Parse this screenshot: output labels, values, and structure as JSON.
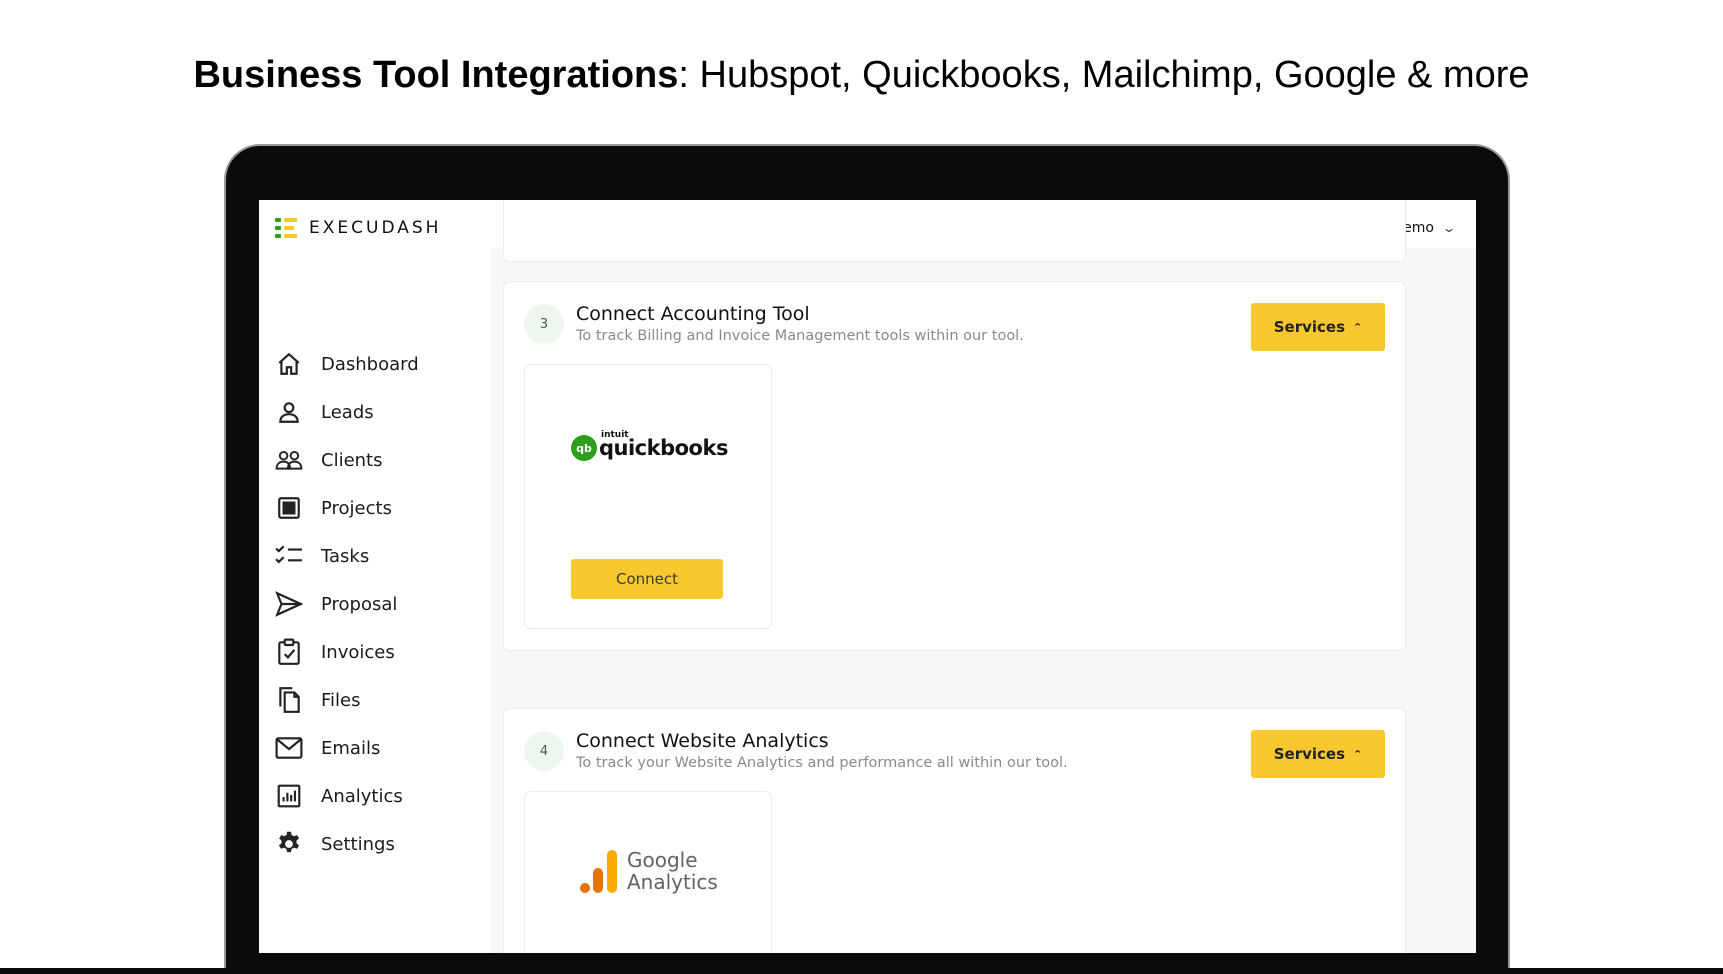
{
  "headline": {
    "bold": "Business Tool Integrations",
    "rest": ": Hubspot, Quickbooks, Mailchimp, Google & more"
  },
  "app": {
    "brand": "EXECUDASH",
    "user_name": "Execudash Demo",
    "accent_color": "#f8c82e",
    "logo_colors": [
      "#2ca01c",
      "#f8c82e"
    ]
  },
  "sidebar": {
    "items": [
      {
        "label": "Dashboard",
        "icon": "home-icon"
      },
      {
        "label": "Leads",
        "icon": "user-icon"
      },
      {
        "label": "Clients",
        "icon": "users-icon"
      },
      {
        "label": "Projects",
        "icon": "grid-icon"
      },
      {
        "label": "Tasks",
        "icon": "checklist-icon"
      },
      {
        "label": "Proposal",
        "icon": "send-icon"
      },
      {
        "label": "Invoices",
        "icon": "clipboard-check-icon"
      },
      {
        "label": "Files",
        "icon": "files-icon"
      },
      {
        "label": "Emails",
        "icon": "mail-icon"
      },
      {
        "label": "Analytics",
        "icon": "chart-icon"
      },
      {
        "label": "Settings",
        "icon": "gear-icon"
      }
    ]
  },
  "steps": [
    {
      "number": "3",
      "title": "Connect Accounting Tool",
      "subtitle": "To track Billing and Invoice Management tools within our tool.",
      "services_label": "Services",
      "integration": {
        "intuit": "intuit",
        "name": "quickbooks",
        "mark": "qb",
        "connect_label": "Connect"
      }
    },
    {
      "number": "4",
      "title": "Connect Website Analytics",
      "subtitle": "To track your Website Analytics and performance all within our tool.",
      "services_label": "Services",
      "integration": {
        "name_line1": "Google",
        "name_line2": "Analytics"
      }
    }
  ]
}
